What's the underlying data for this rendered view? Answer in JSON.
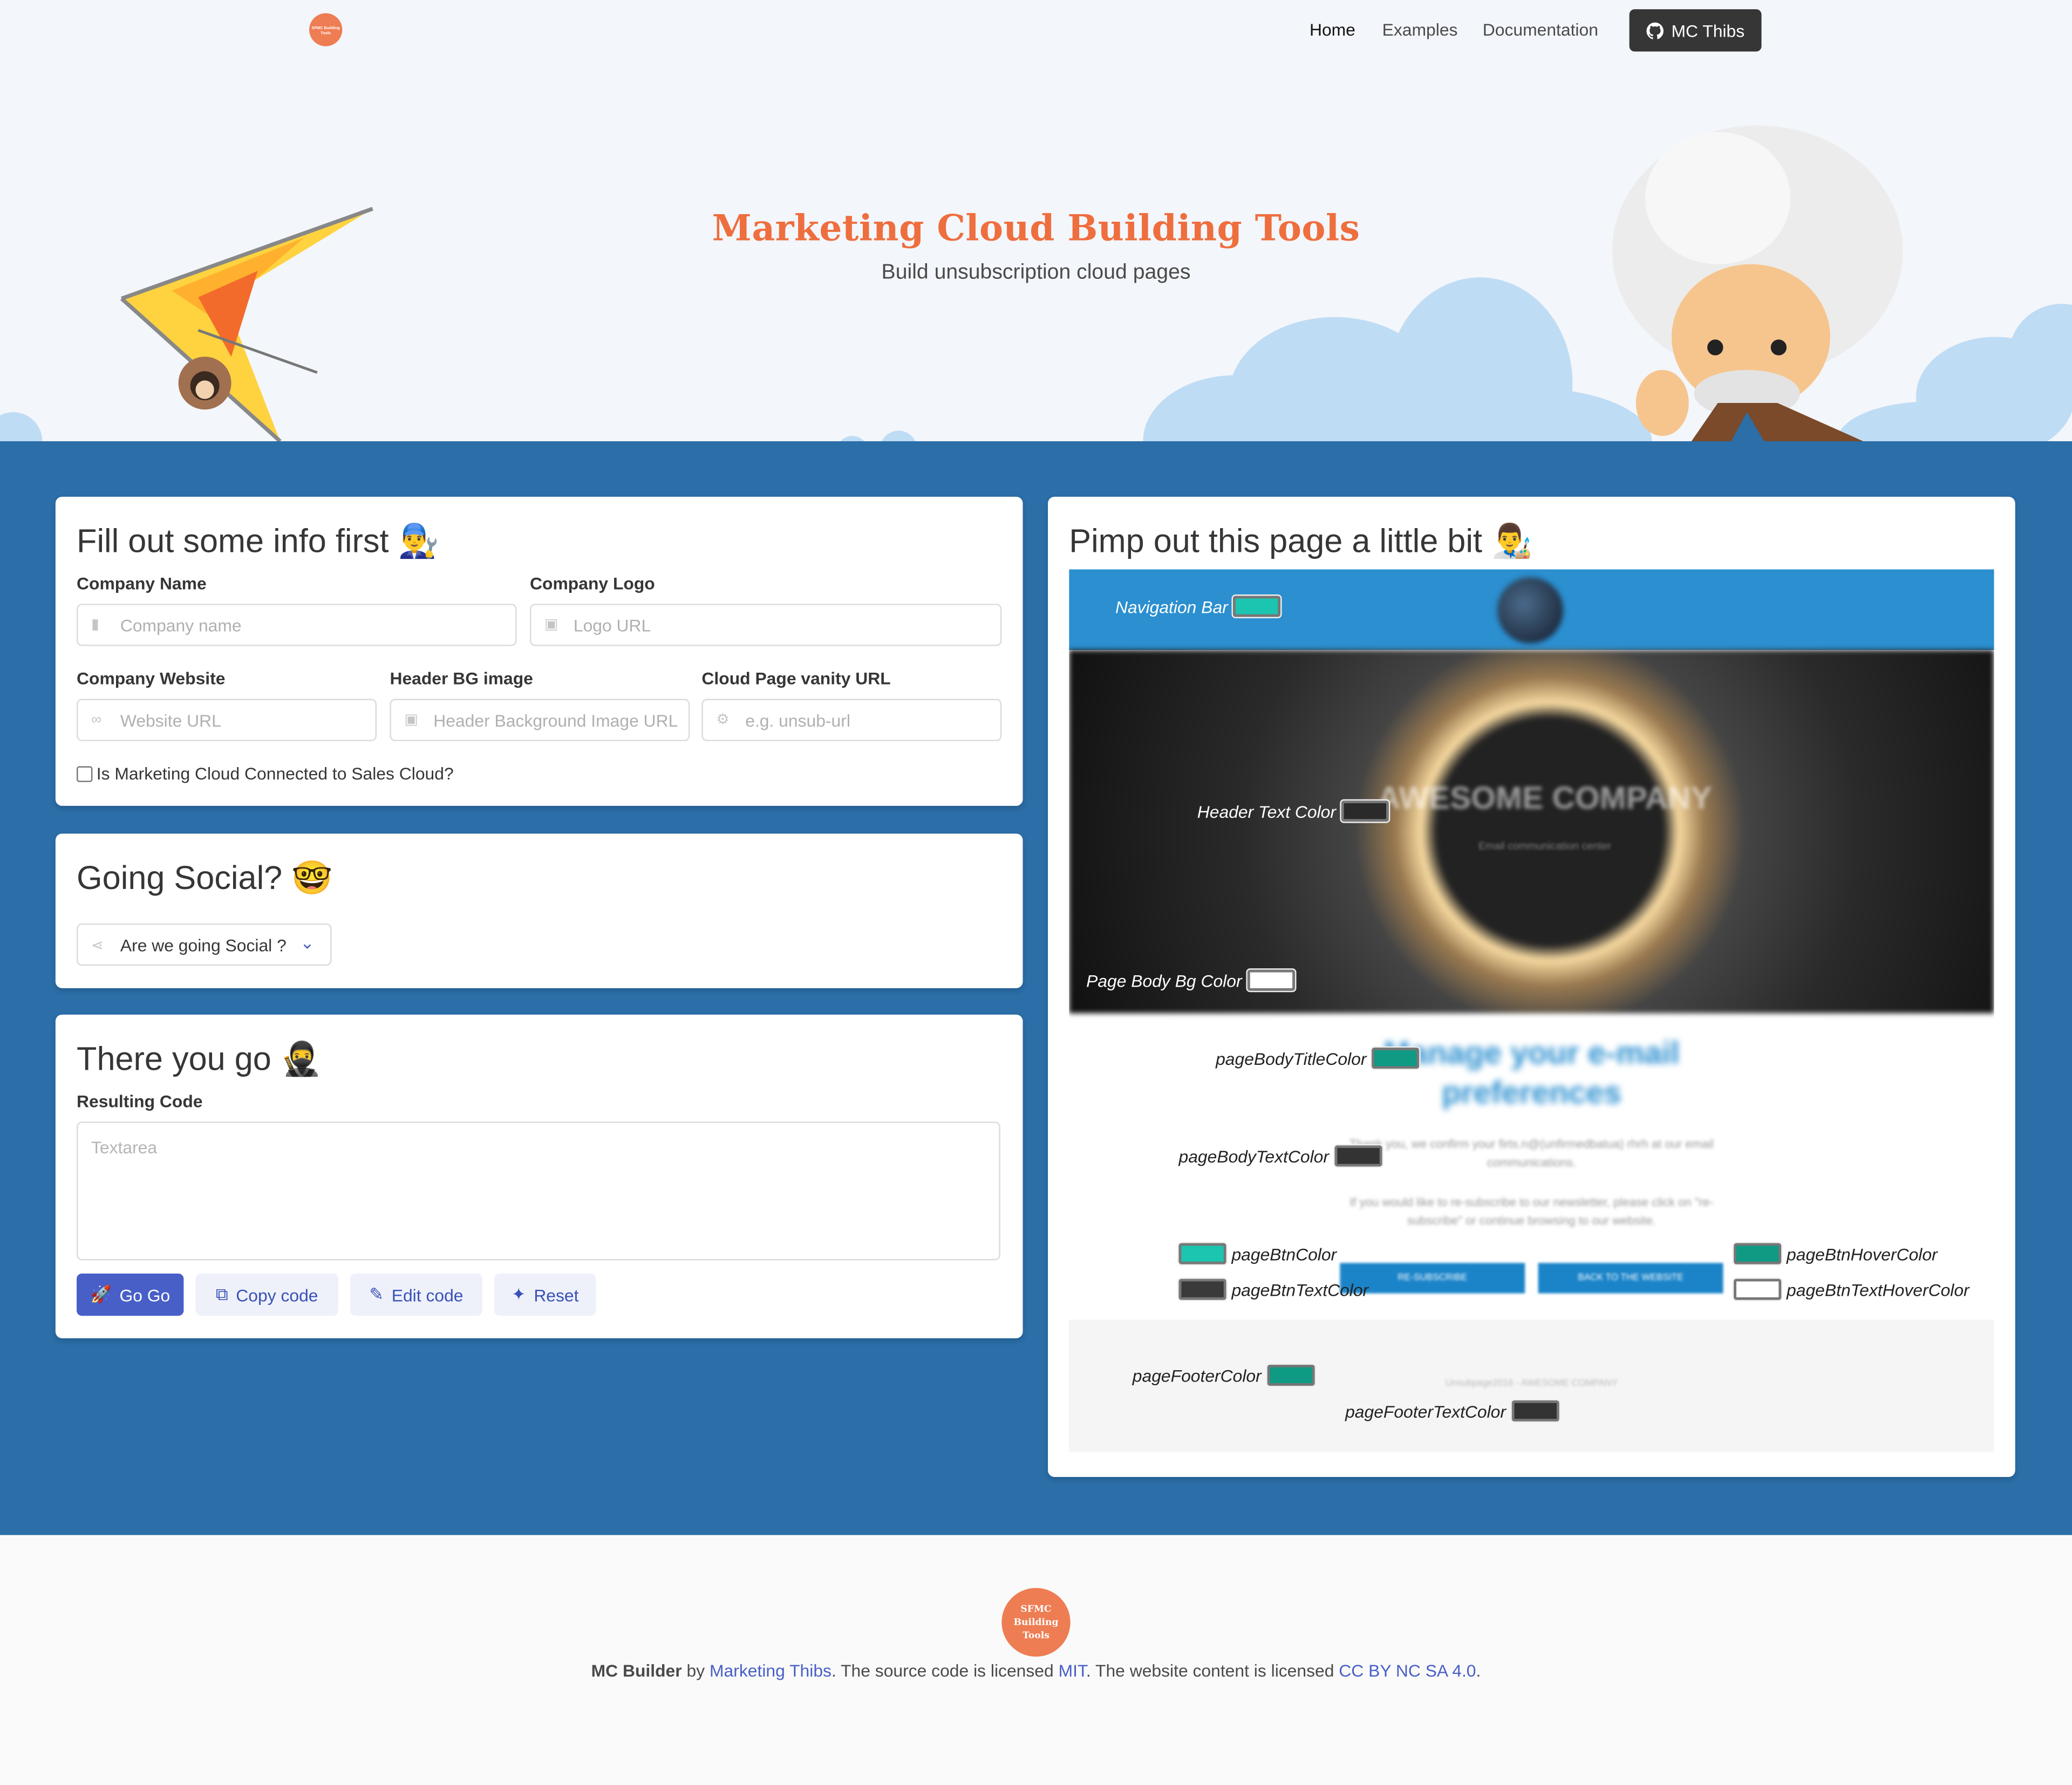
{
  "nav": {
    "logo_text": "SFMC Building Tools",
    "links": [
      "Home",
      "Examples",
      "Documentation"
    ],
    "github_label": "MC Thibs"
  },
  "hero": {
    "title": "Marketing Cloud Building Tools",
    "subtitle": "Build unsubscription cloud pages"
  },
  "info_card": {
    "title": "Fill out some info first 👨‍🔧",
    "company_name_label": "Company Name",
    "company_name_placeholder": "Company name",
    "company_logo_label": "Company Logo",
    "company_logo_placeholder": "Logo URL",
    "company_website_label": "Company Website",
    "company_website_placeholder": "Website URL",
    "header_bg_label": "Header BG image",
    "header_bg_placeholder": "Header Background Image URL",
    "vanity_label": "Cloud Page vanity URL",
    "vanity_placeholder": "e.g. unsub-url",
    "checkbox_label": "Is Marketing Cloud Connected to Sales Cloud?"
  },
  "social_card": {
    "title": "Going Social? 🤓",
    "select_value": "Are we going Social ?"
  },
  "code_card": {
    "title": "There you go 🥷",
    "result_label": "Resulting Code",
    "textarea_placeholder": "Textarea",
    "buttons": {
      "go": "Go Go",
      "copy": "Copy code",
      "edit": "Edit code",
      "reset": "Reset"
    }
  },
  "preview_card": {
    "title": "Pimp out this page a little bit 👨‍🎨",
    "preview_company": "AWESOME COMPANY",
    "preview_tagline": "Email communication center",
    "preview_body_title": "Manage your e-mail preferences",
    "preview_text_1": "Thank you, we confirm your firts.n@(unfirmedbatua) rhrh at our email communications.",
    "preview_text_2": "If you would like to re-subscribe to our newsletter, please click on \"re-subscribe\" or continue browsing to our website.",
    "preview_btn_1": "RE-SUBSCRIBE",
    "preview_btn_2": "BACK TO THE WEBSITE",
    "preview_footer": "Unsubpage2016 - AWESOME COMPANY",
    "swatches": {
      "nav_bar": {
        "label": "Navigation Bar",
        "color": "#1bc5b0"
      },
      "header_text": {
        "label": "Header Text Color",
        "color": "#2a2a2a"
      },
      "page_body_bg": {
        "label": "Page Body Bg Color",
        "color": "#ffffff"
      },
      "body_title": {
        "label": "pageBodyTitleColor",
        "color": "#0f9a84"
      },
      "body_text": {
        "label": "pageBodyTextColor",
        "color": "#333333"
      },
      "btn": {
        "label": "pageBtnColor",
        "color": "#1bc5b0"
      },
      "btn_text": {
        "label": "pageBtnTextColor",
        "color": "#3a3a3a"
      },
      "btn_hover": {
        "label": "pageBtnHoverColor",
        "color": "#0f9a84"
      },
      "btn_text_hover": {
        "label": "pageBtnTextHoverColor",
        "color": "#ffffff"
      },
      "footer": {
        "label": "pageFooterColor",
        "color": "#0f9a84"
      },
      "footer_text": {
        "label": "pageFooterTextColor",
        "color": "#333333"
      }
    }
  },
  "footer": {
    "logo_text": "SFMC Building Tools",
    "brand": "MC Builder",
    "by": " by ",
    "author": "Marketing Thibs",
    "t1": ". The source code is licensed ",
    "license_code": "MIT",
    "t2": ". The website content is licensed ",
    "license_content": "CC BY NC SA 4.0",
    "t3": "."
  }
}
